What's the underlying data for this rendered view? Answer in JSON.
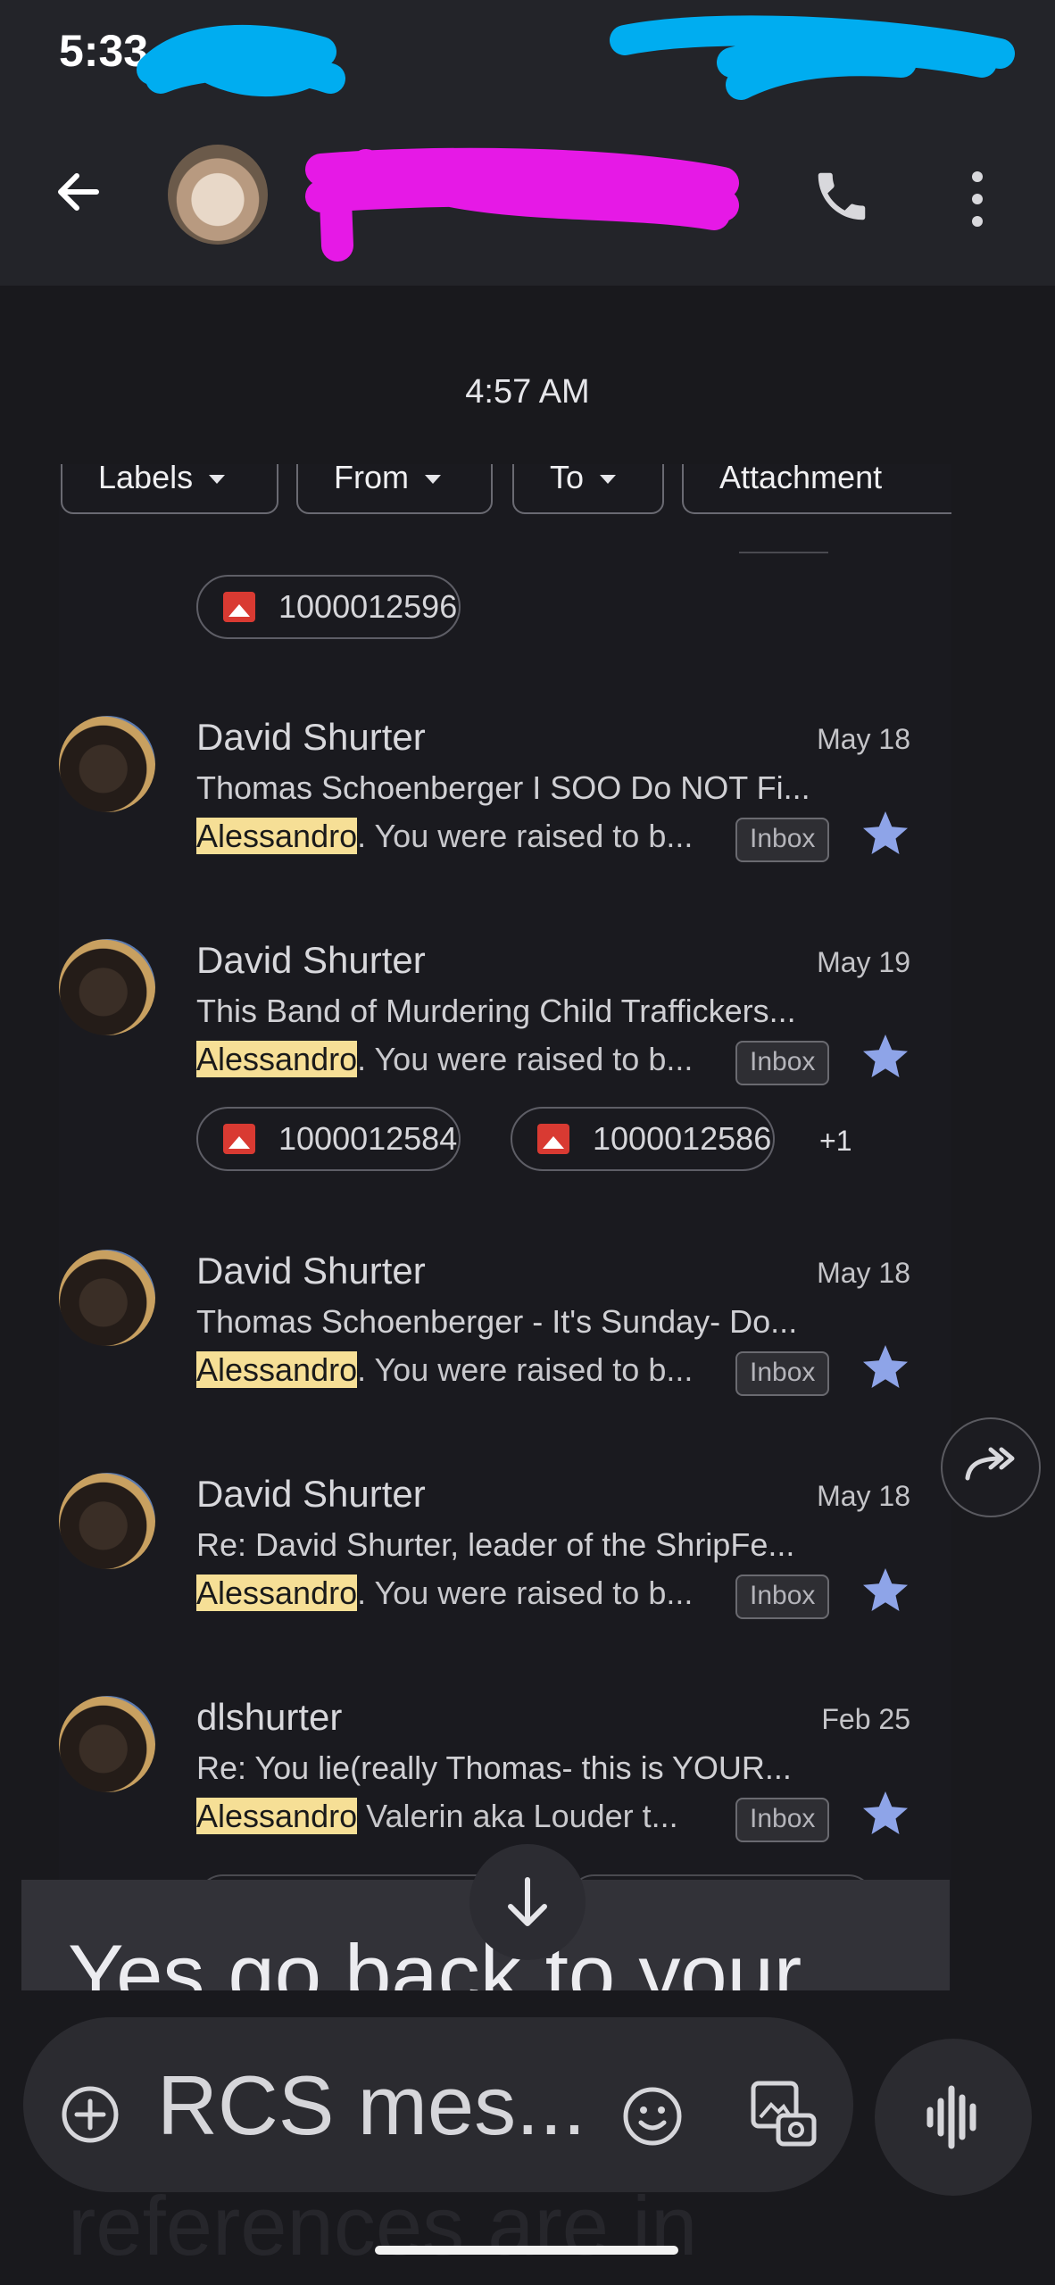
{
  "status": {
    "time": "5:33"
  },
  "colors": {
    "redaction_blue": "#00adf0",
    "redaction_magenta": "#e619e6",
    "highlight": "#f6df96",
    "star": "#8ea4e8",
    "attachment_icon": "#d93a32"
  },
  "header": {
    "contact_avatar": "cat-avatar",
    "call_icon": "phone-icon",
    "menu_icon": "more-vert-icon"
  },
  "conversation": {
    "timestamp": "4:57 AM",
    "screenshot": {
      "filters": [
        "Labels",
        "From",
        "To",
        "Attachment"
      ],
      "top_attachment": "1000012596",
      "emails": [
        {
          "sender": "David Shurter",
          "date": "May 18",
          "subject": "Thomas Schoenberger I SOO Do NOT Fi...",
          "highlight": "Alessandro",
          "snippet_rest": ". You were raised to b...",
          "label": "Inbox",
          "starred": true
        },
        {
          "sender": "David Shurter",
          "date": "May 19",
          "subject": "This Band of Murdering Child Traffickers...",
          "highlight": "Alessandro",
          "snippet_rest": ". You were raised to b...",
          "label": "Inbox",
          "starred": true,
          "attachments": [
            "1000012584",
            "1000012586"
          ],
          "more_attachments": "+1"
        },
        {
          "sender": "David Shurter",
          "date": "May 18",
          "subject": "Thomas Schoenberger - It's Sunday- Do...",
          "highlight": "Alessandro",
          "snippet_rest": ". You were raised to b...",
          "label": "Inbox",
          "starred": true
        },
        {
          "sender": "David Shurter",
          "date": "May 18",
          "subject": "Re: David Shurter, leader of the ShripFe...",
          "highlight": "Alessandro",
          "snippet_rest": ". You were raised to b...",
          "label": "Inbox",
          "starred": true
        },
        {
          "sender": "dlshurter",
          "date": "Feb 25",
          "subject": "Re: You lie(really Thomas- this is YOUR...",
          "highlight": "Alessandro",
          "snippet_rest": " Valerin aka Louder t...",
          "label": "Inbox",
          "starred": true
        }
      ]
    },
    "message_text": "Yes go back to your",
    "message_text_faded": "references are in"
  },
  "composer": {
    "placeholder": "RCS mes..."
  }
}
